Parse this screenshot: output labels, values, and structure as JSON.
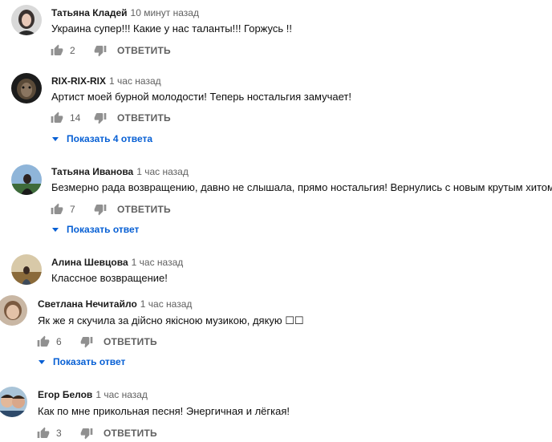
{
  "comments": [
    {
      "author": "Татьяна Кладей",
      "time": "10 минут назад",
      "text": "Украина супер!!! Какие у нас таланты!!! Горжусь !!",
      "likes": "2",
      "reply": "ОТВЕТИТЬ"
    },
    {
      "author": "RIX-RIX-RIX",
      "time": "1 час назад",
      "text": "Артист моей бурной молодости! Теперь ностальгия замучает!",
      "likes": "14",
      "reply": "ОТВЕТИТЬ",
      "replies": "Показать 4 ответа"
    },
    {
      "author": "Татьяна Иванова",
      "time": "1 час назад",
      "text": "Безмерно рада возвращению, давно не слышала, прямо ностальгия! Вернулись с новым крутым хитом!",
      "likes": "7",
      "reply": "ОТВЕТИТЬ",
      "replies": "Показать ответ"
    },
    {
      "author": "Алина Шевцова",
      "time": "1 час назад",
      "text": "Классное возвращение!"
    },
    {
      "author": "Светлана Нечитайло",
      "time": "1 час назад",
      "text": "Як же я скучила за дійсно якісною музикою, дякую ☐☐",
      "likes": "6",
      "reply": "ОТВЕТИТЬ",
      "replies": "Показать ответ"
    },
    {
      "author": "Егор Белов",
      "time": "1 час назад",
      "text": "Как по мне прикольная песня! Энергичная и лёгкая!",
      "likes": "3",
      "reply": "ОТВЕТИТЬ"
    }
  ]
}
